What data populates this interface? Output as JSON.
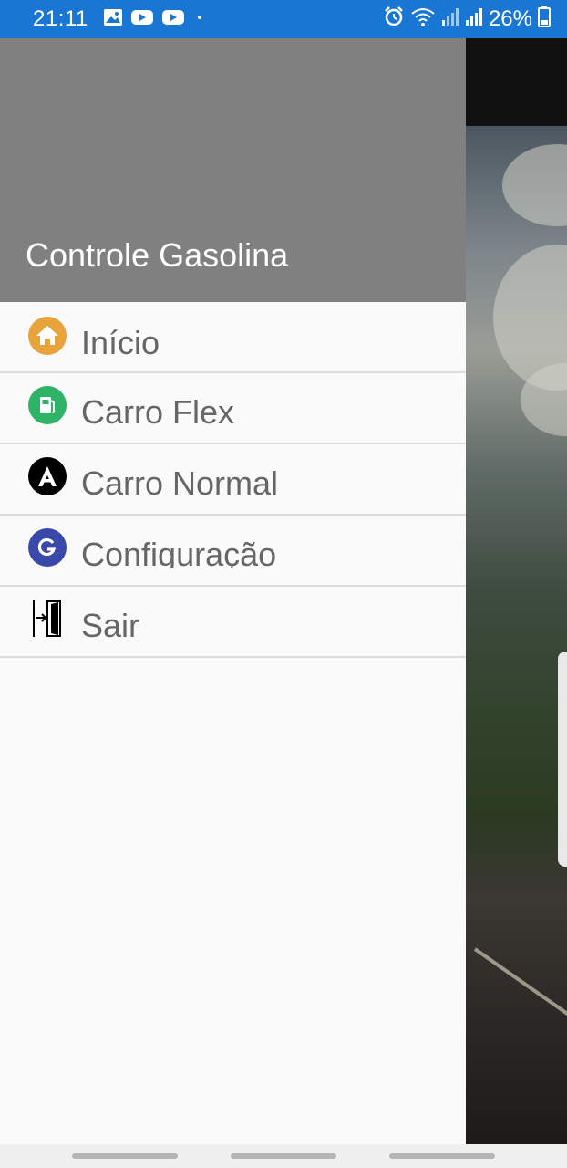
{
  "status_bar": {
    "time": "21:11",
    "battery_percent": "26%",
    "left_icons": [
      "image-icon",
      "youtube-icon",
      "youtube-icon",
      "dot-icon"
    ],
    "right_icons": [
      "alarm-icon",
      "wifi-icon",
      "signal-icon",
      "signal-icon",
      "battery-icon"
    ]
  },
  "drawer": {
    "title": "Controle Gasolina",
    "items": [
      {
        "label": "Início",
        "icon": "home-icon",
        "color": "#e8a33d"
      },
      {
        "label": "Carro Flex",
        "icon": "fuel-pump-icon",
        "color": "#2fb366"
      },
      {
        "label": "Carro Normal",
        "icon": "letter-a-icon",
        "color": "#000000"
      },
      {
        "label": "Configuração",
        "icon": "letter-g-icon",
        "color": "#3949ab"
      },
      {
        "label": "Sair",
        "icon": "exit-door-icon",
        "color": "#000000"
      }
    ]
  },
  "colors": {
    "status_bar": "#1976d2",
    "drawer_header": "#808080",
    "drawer_bg": "#fafafa",
    "menu_text": "#666666"
  }
}
